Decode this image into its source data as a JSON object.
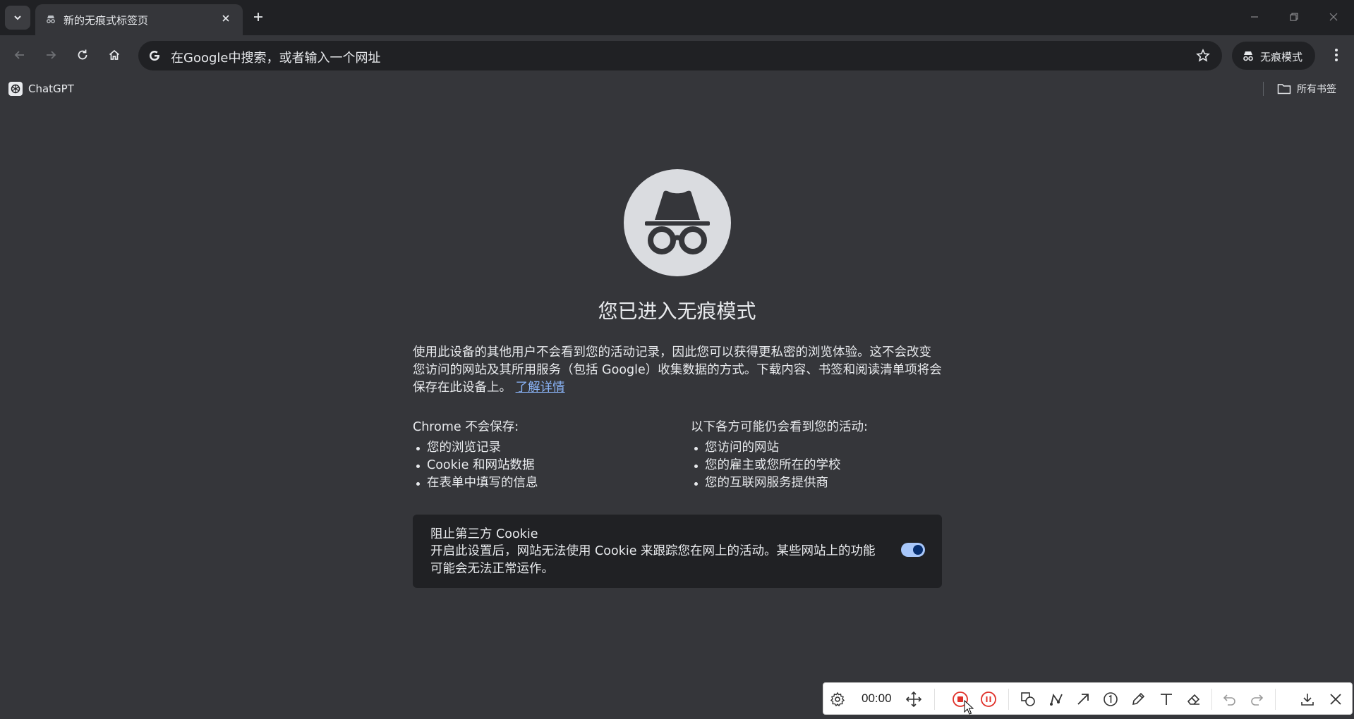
{
  "tab": {
    "title": "新的无痕式标签页"
  },
  "omnibox": {
    "placeholder": "在Google中搜索，或者输入一个网址"
  },
  "profile": {
    "label": "无痕模式"
  },
  "bookmarks": {
    "items": [
      {
        "label": "ChatGPT"
      }
    ],
    "all_label": "所有书签"
  },
  "content": {
    "headline": "您已进入无痕模式",
    "intro": "使用此设备的其他用户不会看到您的活动记录，因此您可以获得更私密的浏览体验。这不会改变您访问的网站及其所用服务（包括 Google）收集数据的方式。下载内容、书签和阅读清单项将会保存在此设备上。",
    "learn_more": "了解详情",
    "left_col": {
      "heading": "Chrome 不会保存:",
      "items": [
        "您的浏览记录",
        "Cookie 和网站数据",
        "在表单中填写的信息"
      ]
    },
    "right_col": {
      "heading": "以下各方可能仍会看到您的活动:",
      "items": [
        "您访问的网站",
        "您的雇主或您所在的学校",
        "您的互联网服务提供商"
      ]
    },
    "cookie": {
      "title": "阻止第三方 Cookie",
      "description": "开启此设置后，网站无法使用 Cookie 来跟踪您在网上的活动。某些网站上的功能可能会无法正常运作。",
      "enabled": true
    }
  },
  "recorder": {
    "timer": "00:00"
  },
  "colors": {
    "page_bg": "#35363a",
    "tabstrip_bg": "#202124",
    "link": "#8ab4f8",
    "toggle_on": "#a8c7fa",
    "record_red": "#e0312a"
  }
}
